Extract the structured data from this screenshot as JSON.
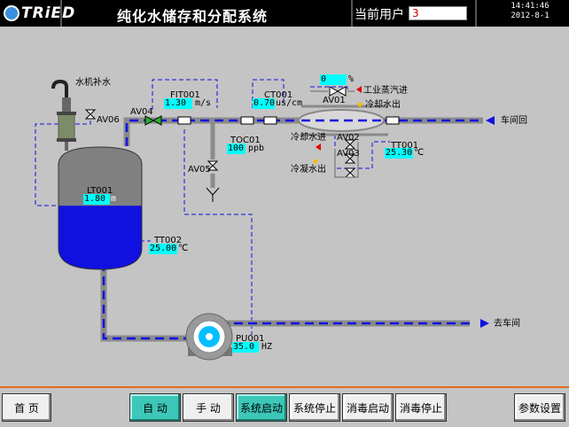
{
  "header": {
    "logo": "TRiED",
    "title": "纯化水储存和分配系统",
    "user_label": "当前用户",
    "user_value": "3",
    "time": "14:41:46",
    "date": "2012-8-1"
  },
  "process": {
    "make_up_water": "水机补水",
    "av06": "AV06",
    "av04": "AV04",
    "av05": "AV05",
    "fit001": {
      "tag": "FIT001",
      "value": "1.30",
      "unit": "m/s"
    },
    "ct001": {
      "tag": "CT001",
      "value": "0.70",
      "unit": "us/cm"
    },
    "toc01": {
      "tag": "TOC01",
      "value": "100",
      "unit": "ppb"
    },
    "lt001": {
      "tag": "LT001",
      "value": "1.80",
      "unit": "m"
    },
    "tt002": {
      "tag": "TT002",
      "value": "25.00",
      "unit": "℃"
    },
    "tt001": {
      "tag": "TT001",
      "value": "25.30",
      "unit": "℃"
    },
    "pu001": {
      "tag": "PU001",
      "value": "35.0",
      "unit": "HZ"
    },
    "percent": {
      "value": "0",
      "unit": "%"
    },
    "av01": "AV01",
    "av02": "AV02",
    "av03": "AV03",
    "steam_in": "工业蒸汽进",
    "cooling_water_out": "冷却水出",
    "cooling_water_in": "冷却水进",
    "condensate_out": "冷凝水出",
    "return_workshop": "车间回",
    "to_workshop": "去车间",
    "tank_level_fraction": 0.52
  },
  "colors": {
    "pipe": "#1010e0",
    "tank_water": "#1010e0",
    "tank_air": "#808080",
    "value_bg": "#00ffff",
    "accent_orange": "#e26a1c",
    "active_button": "#3cc7b8"
  },
  "footer": {
    "home": "首  页",
    "auto": "自  动",
    "manual": "手  动",
    "system_start": "系统启动",
    "system_stop": "系统停止",
    "sanitize_start": "消毒启动",
    "sanitize_stop": "消毒停止",
    "params": "参数设置"
  }
}
